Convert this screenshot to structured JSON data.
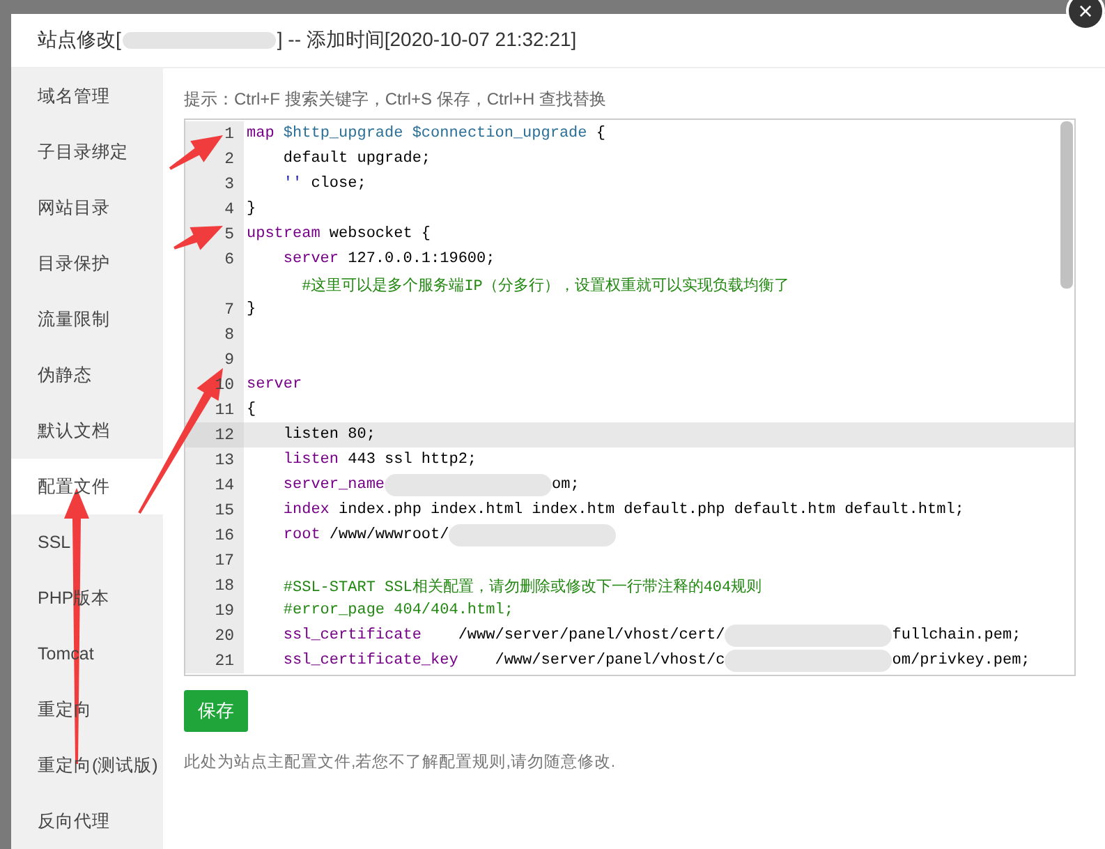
{
  "dialog": {
    "title_start": "站点修改[",
    "title_end": "] -- 添加时间[2020-10-07 21:32:21]",
    "close": "×"
  },
  "sidebar": {
    "items": [
      {
        "label": "域名管理",
        "selected": false
      },
      {
        "label": "子目录绑定",
        "selected": false
      },
      {
        "label": "网站目录",
        "selected": false
      },
      {
        "label": "目录保护",
        "selected": false
      },
      {
        "label": "流量限制",
        "selected": false
      },
      {
        "label": "伪静态",
        "selected": false
      },
      {
        "label": "默认文档",
        "selected": false
      },
      {
        "label": "配置文件",
        "selected": true
      },
      {
        "label": "SSL",
        "selected": false
      },
      {
        "label": "PHP版本",
        "selected": false
      },
      {
        "label": "Tomcat",
        "selected": false
      },
      {
        "label": "重定向",
        "selected": false
      },
      {
        "label": "重定向(测试版)",
        "selected": false
      },
      {
        "label": "反向代理",
        "selected": false
      }
    ]
  },
  "hint": "提示：Ctrl+F 搜索关键字，Ctrl+S 保存，Ctrl+H 查找替换",
  "editor": {
    "lines": [
      {
        "number": "1",
        "active": false,
        "tokens": [
          {
            "kind": "keyword",
            "text": "map"
          },
          {
            "kind": "variable",
            "text": " $http_upgrade"
          },
          {
            "kind": "variable",
            "text": " $connection_upgrade"
          },
          {
            "kind": "plain",
            "text": " {"
          }
        ]
      },
      {
        "number": "2",
        "active": false,
        "tokens": [
          {
            "kind": "plain",
            "text": "    default upgrade;"
          }
        ]
      },
      {
        "number": "3",
        "active": false,
        "tokens": [
          {
            "kind": "string",
            "text": "    ''"
          },
          {
            "kind": "plain",
            "text": " close;"
          }
        ]
      },
      {
        "number": "4",
        "active": false,
        "tokens": [
          {
            "kind": "plain",
            "text": "}"
          }
        ]
      },
      {
        "number": "5",
        "active": false,
        "tokens": [
          {
            "kind": "keyword",
            "text": "upstream"
          },
          {
            "kind": "plain",
            "text": " websocket {"
          }
        ]
      },
      {
        "number": "6",
        "active": false,
        "tokens": [
          {
            "kind": "keyword",
            "text": "    server"
          },
          {
            "kind": "plain",
            "text": " 127.0.0.1:19600;"
          }
        ],
        "wrapped": [
          {
            "kind": "comment",
            "text": "      #这里可以是多个服务端IP（分多行），设置权重就可以实现负载均衡了"
          }
        ]
      },
      {
        "number": "7",
        "active": false,
        "tokens": [
          {
            "kind": "plain",
            "text": "}"
          }
        ]
      },
      {
        "number": "8",
        "active": false
      },
      {
        "number": "9",
        "active": false
      },
      {
        "number": "10",
        "active": false,
        "tokens": [
          {
            "kind": "keyword",
            "text": "server"
          }
        ]
      },
      {
        "number": "11",
        "active": false,
        "tokens": [
          {
            "kind": "plain",
            "text": "{"
          }
        ]
      },
      {
        "number": "12",
        "active": true,
        "tokens": [
          {
            "kind": "plain",
            "text": "    listen 80;"
          }
        ]
      },
      {
        "number": "13",
        "active": false,
        "tokens": [
          {
            "kind": "keyword",
            "text": "    listen"
          },
          {
            "kind": "plain",
            "text": " 443 ssl http2;"
          }
        ]
      },
      {
        "number": "14",
        "active": false,
        "tokens": [
          {
            "kind": "keyword",
            "text": "    server_name"
          },
          {
            "kind": "redacted"
          },
          {
            "kind": "plain",
            "text": "om;"
          }
        ]
      },
      {
        "number": "15",
        "active": false,
        "tokens": [
          {
            "kind": "keyword",
            "text": "    index"
          },
          {
            "kind": "plain",
            "text": " index.php index.html index.htm default.php default.htm default.html;"
          }
        ]
      },
      {
        "number": "16",
        "active": false,
        "tokens": [
          {
            "kind": "keyword",
            "text": "    root"
          },
          {
            "kind": "plain",
            "text": " /www/wwwroot/"
          },
          {
            "kind": "redacted"
          }
        ]
      },
      {
        "number": "17",
        "active": false
      },
      {
        "number": "18",
        "active": false,
        "tokens": [
          {
            "kind": "comment",
            "text": "    #SSL-START SSL相关配置，请勿删除或修改下一行带注释的404规则"
          }
        ]
      },
      {
        "number": "19",
        "active": false,
        "tokens": [
          {
            "kind": "comment",
            "text": "    #error_page 404/404.html;"
          }
        ]
      },
      {
        "number": "20",
        "active": false,
        "tokens": [
          {
            "kind": "keyword",
            "text": "    ssl_certificate"
          },
          {
            "kind": "plain",
            "text": "    /www/server/panel/vhost/cert/"
          },
          {
            "kind": "redacted"
          },
          {
            "kind": "plain",
            "text": "fullchain.pem;"
          }
        ]
      },
      {
        "number": "21",
        "active": false,
        "tokens": [
          {
            "kind": "keyword",
            "text": "    ssl_certificate_key"
          },
          {
            "kind": "plain",
            "text": "    /www/server/panel/vhost/c"
          },
          {
            "kind": "redacted"
          },
          {
            "kind": "plain",
            "text": "om/privkey.pem;"
          }
        ]
      }
    ]
  },
  "save_button": "保存",
  "note": "此处为站点主配置文件,若您不了解配置规则,请勿随意修改."
}
